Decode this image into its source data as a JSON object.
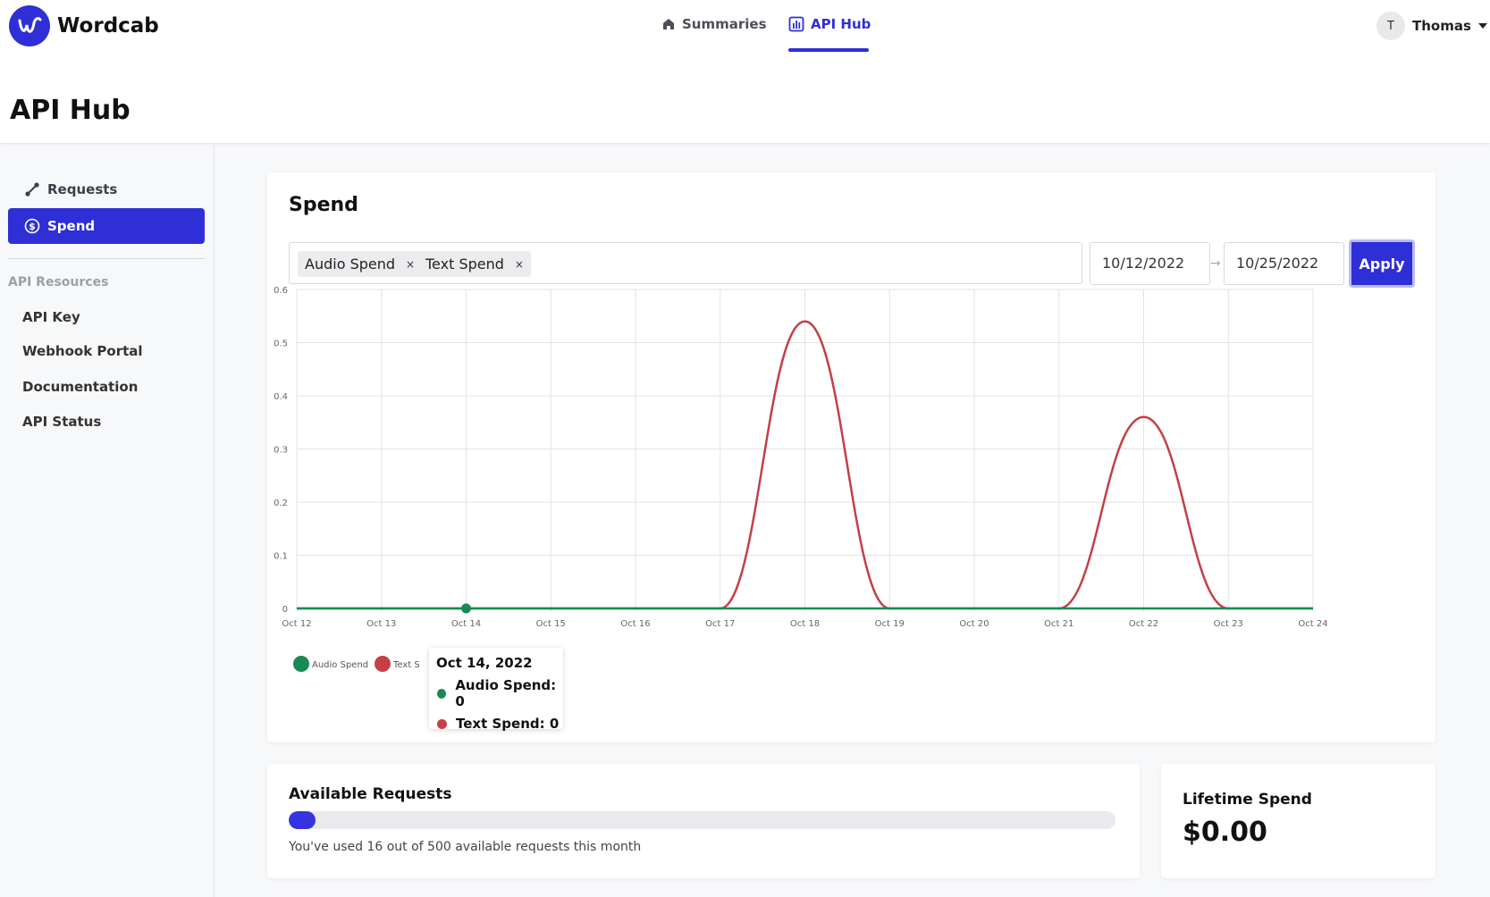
{
  "app": {
    "name": "Wordcab"
  },
  "nav": {
    "summaries_label": "Summaries",
    "apihub_label": "API Hub",
    "user_initial": "T",
    "user_name": "Thomas"
  },
  "page": {
    "title": "API Hub"
  },
  "sidebar": {
    "requests_label": "Requests",
    "spend_label": "Spend",
    "resources_heading": "API Resources",
    "links": [
      "API Key",
      "Webhook Portal",
      "Documentation",
      "API Status"
    ]
  },
  "spend": {
    "title": "Spend",
    "tags": [
      "Audio Spend",
      "Text Spend"
    ],
    "tag_remove": "×",
    "start_date": "10/12/2022",
    "end_date": "10/25/2022",
    "arrow": "→",
    "apply_label": "Apply"
  },
  "tooltip": {
    "title": "Oct 14, 2022",
    "rows": [
      "Audio Spend: 0",
      "Text Spend: 0"
    ]
  },
  "requests": {
    "title": "Available Requests",
    "used": 16,
    "total": 500,
    "progress_fraction": 0.032,
    "note": "You've used 16 out of 500 available requests this month"
  },
  "lifetime": {
    "title": "Lifetime Spend",
    "value": "$0.00"
  },
  "colors": {
    "accent": "#2e2fd6",
    "audio": "#1a8a55",
    "text": "#c43f46"
  },
  "icons": {
    "summaries": "home-icon",
    "apihub": "bar-chart-icon",
    "requests": "requests-icon",
    "spend": "dollar-circle-icon"
  },
  "chart_data": {
    "type": "line",
    "x": [
      "Oct 12",
      "Oct 13",
      "Oct 14",
      "Oct 15",
      "Oct 16",
      "Oct 17",
      "Oct 18",
      "Oct 19",
      "Oct 20",
      "Oct 21",
      "Oct 22",
      "Oct 23",
      "Oct 24"
    ],
    "series": [
      {
        "name": "Audio Spend",
        "color": "#1a8a55",
        "values": [
          0,
          0,
          0,
          0,
          0,
          0,
          0,
          0,
          0,
          0,
          0,
          0,
          0
        ]
      },
      {
        "name": "Text Spend",
        "color": "#c43f46",
        "values": [
          0,
          0,
          0,
          0,
          0,
          0,
          0.54,
          0,
          0,
          0,
          0.36,
          0,
          0
        ]
      }
    ],
    "y_ticks": [
      "0",
      "0.1",
      "0.2",
      "0.3",
      "0.4",
      "0.5",
      "0.6"
    ],
    "ylim": [
      0,
      0.6
    ],
    "grid": true,
    "legend": "bottom-left",
    "legend_labels": [
      "Audio Spend",
      "Text S"
    ],
    "highlight": {
      "index": 2,
      "series": "Audio Spend"
    }
  }
}
